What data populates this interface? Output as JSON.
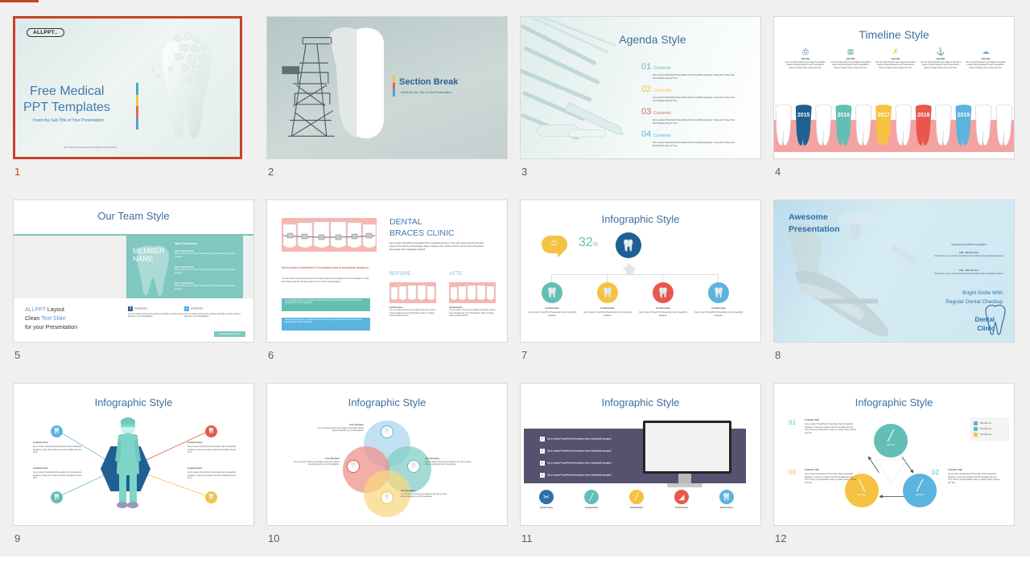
{
  "page": {
    "background_color": "#f0f0f0",
    "accent_color": "#c8412a",
    "loading_bar_color": "#c8412a"
  },
  "slides": [
    {
      "number": "1",
      "selected": true,
      "name": "title-slide",
      "logo": "ALLPPT..",
      "title_line1": "Free Medical",
      "title_line2": "PPT Templates",
      "subtitle": "Insert the Sub Title of Your Presentation",
      "url": "http://www.free-powerpoint-templates-design.com",
      "accent_bars": [
        "#4aa7c9",
        "#f5c242",
        "#e0685e",
        "#5b9bd5"
      ]
    },
    {
      "number": "2",
      "selected": false,
      "name": "section-break-slide",
      "title": "Section Break",
      "subtitle": "Insert the Sub Title of Your Presentation",
      "accent_bars": [
        "#f5c242",
        "#e0685e",
        "#4aa7c9"
      ]
    },
    {
      "number": "3",
      "selected": false,
      "name": "agenda-slide",
      "title": "Agenda Style",
      "items": [
        {
          "num": "01",
          "label": "Contents",
          "color": "#63bfb4",
          "body": "Get a modern PowerPoint  Presentation that is beautifully designed. I hope and I believe that this Template will your Time."
        },
        {
          "num": "02",
          "label": "Contents",
          "color": "#f5c242",
          "body": "Get a modern PowerPoint  Presentation that is beautifully designed. I hope and I believe that this Template will your Time."
        },
        {
          "num": "03",
          "label": "Contents",
          "color": "#e0685e",
          "body": "Get a modern PowerPoint  Presentation that is beautifully designed. I hope and I believe that this Template will your Time."
        },
        {
          "num": "04",
          "label": "Contents",
          "color": "#5bb4dd",
          "body": "Get a modern PowerPoint  Presentation that is beautifully designed. I hope and I believe that this Template will your Time."
        }
      ]
    },
    {
      "number": "4",
      "selected": false,
      "name": "timeline-slide",
      "title": "Timeline Style",
      "columns": [
        {
          "icon": "printer-icon",
          "glyph": "⎙",
          "color": "#2f6fa8",
          "heading": "Add Title",
          "body": "You can simply impress your audience and add a unique zing and appeal to your Presentations. Easy to change colors, photos and Text."
        },
        {
          "icon": "folder-icon",
          "glyph": "☷",
          "color": "#63bfb4",
          "heading": "Add Title",
          "body": "You can simply impress your audience and add a unique zing and appeal to your Presentations. Easy to change colors, photos and Text."
        },
        {
          "icon": "syringe-icon",
          "glyph": "✗",
          "color": "#f5c242",
          "heading": "Add Title",
          "body": "You can simply impress your audience and add a unique zing and appeal to your Presentations. Easy to change colors, photos and Text."
        },
        {
          "icon": "anchor-icon",
          "glyph": "⚓",
          "color": "#e0685e",
          "heading": "Add Title",
          "body": "You can simply impress your audience and add a unique zing and appeal to your Presentations. Easy to change colors, photos and Text."
        },
        {
          "icon": "cloud-icon",
          "glyph": "⛅",
          "color": "#5bb4dd",
          "heading": "Add Title",
          "body": "You can simply impress your audience and add a unique zing and appeal to your Presentations. Easy to change colors, photos and Text."
        }
      ],
      "years": [
        {
          "label": "2015",
          "color": "#1f5f92"
        },
        {
          "label": "2016",
          "color": "#63bfb4"
        },
        {
          "label": "2017",
          "color": "#f5c242"
        },
        {
          "label": "2018",
          "color": "#e8574c"
        },
        {
          "label": "2019",
          "color": "#5bb4dd"
        }
      ],
      "gum_color": "#f4a3a0"
    },
    {
      "number": "5",
      "selected": false,
      "name": "team-slide",
      "title": "Our Team Style",
      "member_name_line1": "MEMBER",
      "member_name_line2": "NAME",
      "work_experience_heading": "Work Experience",
      "experience": [
        {
          "period": "2010 - 2014  Text here",
          "body": "Sample Text : Get a modern PowerPoint  Presentation that is beautifully designed"
        },
        {
          "period": "2014 - 2016 Text here",
          "body": "Sample Text : Get a modern PowerPoint  Presentation that is beautifully designed"
        },
        {
          "period": "2016 - 2018  Text here",
          "body": "Sample Text : Get a modern PowerPoint  Presentation that is beautifully designed"
        }
      ],
      "layout_line1_a": "ALLPPT",
      "layout_line1_b": "Layout",
      "layout_line2_a": "Clean",
      "layout_line2_b": "Text Slide",
      "layout_line3": "for your Presentation",
      "socials": [
        {
          "name": "FACEBOOK",
          "color": "#3b5998",
          "body": "You can simply impress your audience and add a unique zing and appeal to your Presentations."
        },
        {
          "name": "@TWITTER",
          "color": "#55acee",
          "body": "You can simply impress your audience and add a unique zing and appeal to your Presentations."
        }
      ],
      "button": "www.homepageurl.com"
    },
    {
      "number": "6",
      "selected": false,
      "name": "braces-clinic-slide",
      "title_line1": "DENTAL",
      "title_line2": "BRACES CLINIC",
      "intro": "Get a modern PowerPoint  Presentation that is beautifully designed. I hope and I believe that this Template will your Time, Money and Reputation. Easy to change colors, photos and Text. Get a modern PowerPoint  Presentation that is beautifully designed.",
      "red_heading": "Get a modern PowerPoint  Presentation that is beautifully designed.",
      "gray_body": "You can simply impress your audience and add a unique zing and appeal to your Presentations. I hope and I believe that this Template will your Time, Money and Reputation.",
      "bars": [
        {
          "color": "#63bfb4",
          "text": "You can simply impress your audience and add a unique zing and appeal to your Reports and Presentations with our Templates."
        },
        {
          "color": "#5bb4dd",
          "text": "You can simply impress your audience and add a unique zing and appeal to your Reports and Presentations with our Templates."
        }
      ],
      "before_label": "BEFORE",
      "after_label": "AFTE",
      "before_caption_title": "Content  Here",
      "before_caption": "You can simply impress your audience and add a unique zing and appeal to your Presentations. Easy to change colors, photos and Text.",
      "after_caption_title": "Content  Here",
      "after_caption": "You can simply impress your audience and add a unique zing and appeal to your Presentations. Easy to change colors, photos and Text."
    },
    {
      "number": "7",
      "selected": false,
      "name": "infographic-hierarchy-slide",
      "title": "Infographic Style",
      "bubble_line1": "Text",
      "bubble_line2": "Here !",
      "percent": "32",
      "percent_symbol": "%",
      "hub_icon": "tooth-icon",
      "nodes": [
        {
          "color": "#63bfb4",
          "icon": "tooth-icon",
          "heading": "Content  Here",
          "body": "Get a modern PowerPoint  Presentation that is beautifully designed."
        },
        {
          "color": "#f5c242",
          "icon": "tooth-icon",
          "heading": "Content  Here",
          "body": "Get a modern PowerPoint  Presentation that is beautifully designed."
        },
        {
          "color": "#e8574c",
          "icon": "tooth-icon",
          "heading": "Content  Here",
          "body": "Get a modern PowerPoint  Presentation that is beautifully designed."
        },
        {
          "color": "#5bb4dd",
          "icon": "tooth-icon",
          "heading": "Content  Here",
          "body": "Get a modern PowerPoint  Presentation that is beautifully designed."
        }
      ]
    },
    {
      "number": "8",
      "selected": false,
      "name": "awesome-presentation-slide",
      "title_line1": "Awesome",
      "title_line2": "Presentation",
      "side_heading": "Awesome PowerPoint  Presentation",
      "side_blocks": [
        {
          "period": "2008 - 2012  Text here",
          "body": "Sample Text : Get a modern PowerPoint  Presentation that is beautifully designed"
        },
        {
          "period": "2012 - 2020  Text here",
          "body": "Sample Text : Get a modern PowerPoint  Presentation that is beautifully designed"
        }
      ],
      "tagline_line1": "Bright Smile With",
      "tagline_line2": "Regular Dental Checkup",
      "brand_line1": "Dental",
      "brand_line2": "Clinic"
    },
    {
      "number": "9",
      "selected": false,
      "name": "infographic-doctor-slide",
      "title": "Infographic Style",
      "nodes": [
        {
          "color": "#5bb4dd",
          "icon": "tooth-icon",
          "heading": "Contents  Here",
          "body": "Get a modern PowerPoint  Presentation that is beautifully designed. I hope and I believe that this Template will your Time."
        },
        {
          "color": "#e8574c",
          "icon": "tooth-icon",
          "heading": "Contents  Here",
          "body": "Get a modern PowerPoint  Presentation that is beautifully designed. I hope and I believe that this Template will your Time."
        },
        {
          "color": "#63bfb4",
          "icon": "tooth-icon",
          "heading": "Contents  Here",
          "body": "Get a modern PowerPoint  Presentation that is beautifully designed. I hope and I believe that this Template will your Time."
        },
        {
          "color": "#f5c242",
          "icon": "tooth-icon",
          "heading": "Contents  Here",
          "body": "Get a modern PowerPoint  Presentation that is beautifully designed. I hope and I believe that this Template will your Time."
        }
      ]
    },
    {
      "number": "10",
      "selected": false,
      "name": "infographic-venn-slide",
      "title": "Infographic Style",
      "nodes": [
        {
          "color": "#5bb4dd",
          "icon": "tooth-icon",
          "heading": "Your Text Here",
          "body": "You can simply impress your audience and add a unique zing and appeal to your Presentations."
        },
        {
          "color": "#63bfb4",
          "icon": "tooth-icon",
          "heading": "Your Text Here",
          "body": "You can simply impress your audience and add a unique zing and appeal to your Presentations."
        },
        {
          "color": "#e8574c",
          "icon": "tooth-icon",
          "heading": "Your Text Here",
          "body": "You can simply impress your audience and add a unique zing and appeal to your Presentations."
        },
        {
          "color": "#f5c242",
          "icon": "tooth-icon",
          "heading": "Your Text Here",
          "body": "You can simply impress your audience and add a unique zing and appeal to your Presentations."
        }
      ]
    },
    {
      "number": "11",
      "selected": false,
      "name": "infographic-monitor-slide",
      "title": "Infographic Style",
      "band_color": "#54526e",
      "checklist": [
        "Get a modern PowerPoint  Presentation that is beautifully designed",
        "Get a modern PowerPoint  Presentation that is beautifully designed",
        "Get a modern PowerPoint  Presentation that is beautifully designed",
        "Get a modern PowerPoint  Presentation that is beautifully designed"
      ],
      "nodes": [
        {
          "color": "#2f6fa8",
          "icon": "drill-icon",
          "label": "Content  Here"
        },
        {
          "color": "#63bfb4",
          "icon": "probe-icon",
          "label": "Content  Here"
        },
        {
          "color": "#f5c242",
          "icon": "scaler-icon",
          "label": "Content  Here"
        },
        {
          "color": "#e8574c",
          "icon": "mirror-icon",
          "label": "Content  Here"
        },
        {
          "color": "#5bb4dd",
          "icon": "tooth-icon",
          "label": "Content  Here"
        }
      ]
    },
    {
      "number": "12",
      "selected": false,
      "name": "infographic-cycle-slide",
      "title": "Infographic Style",
      "circles": [
        {
          "color": "#63bfb4",
          "icon": "scaler-icon",
          "label": "Add Text"
        },
        {
          "color": "#5bb4dd",
          "icon": "probe-icon",
          "label": "Add Text"
        },
        {
          "color": "#f5c242",
          "icon": "drill-icon",
          "label": "Add Text"
        }
      ],
      "items": [
        {
          "num": "01",
          "color": "#63bfb4",
          "heading": "Contents  Title",
          "body": "Get a modern PowerPoint  Presentation that is beautifully designed. I hope and I believe that this Template will your Time, Money and Reputation. Easy to change colors, photos and Text."
        },
        {
          "num": "02",
          "color": "#5bb4dd",
          "heading": "Contents  Title",
          "body": "Get a modern PowerPoint  Presentation that is beautifully designed. I hope and I believe that this Template will your Time, Money and Reputation. Easy to change colors, photos and Text."
        },
        {
          "num": "03",
          "color": "#f5c242",
          "heading": "Contents  Title",
          "body": "Get a modern PowerPoint  Presentation that is beautifully designed. I hope and I believe that this Template will your Time, Money and Reputation. Easy to change colors, photos and Text."
        }
      ],
      "legend": [
        {
          "color": "#5bb4dd",
          "label": "80% Add Text"
        },
        {
          "color": "#63bfb4",
          "label": "60% Add Text"
        },
        {
          "color": "#f5c242",
          "label": "40% Add Text"
        }
      ]
    }
  ]
}
